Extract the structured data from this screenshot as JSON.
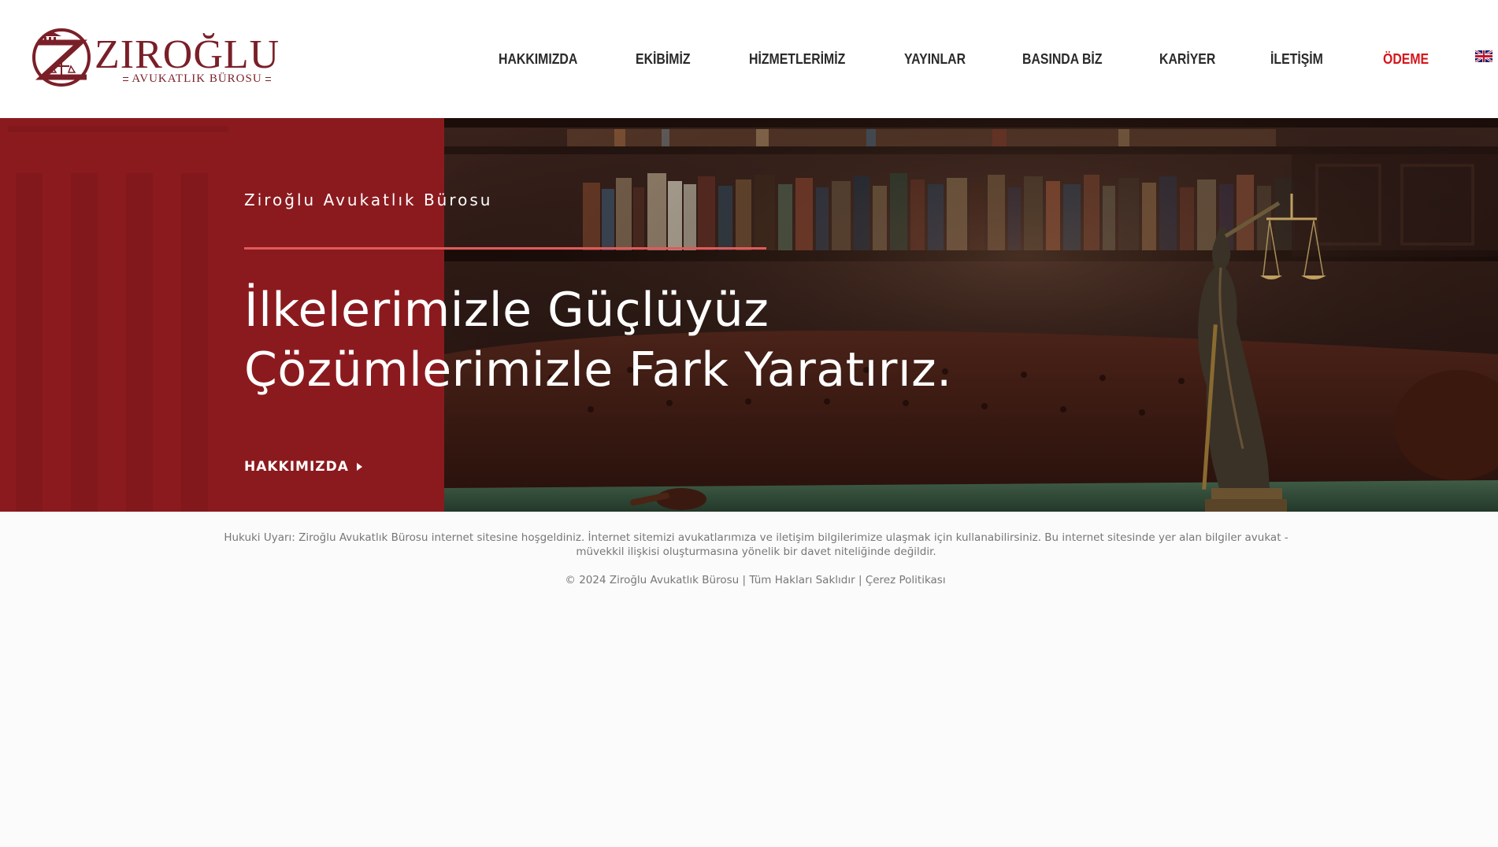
{
  "brand": {
    "name": "ZIROĞLU",
    "subtitle": "AVUKATLIK BÜROSU",
    "colors": {
      "primary": "#7a1f28",
      "accent": "#d4161b",
      "hero_panel": "#8b1a1e"
    }
  },
  "nav": {
    "items": [
      {
        "label": "HAKKIMIZDA"
      },
      {
        "label": "EKİBİMİZ"
      },
      {
        "label": "HİZMETLERİMİZ"
      },
      {
        "label": "YAYINLAR"
      },
      {
        "label": "BASINDA BİZ"
      },
      {
        "label": "KARİYER"
      },
      {
        "label": "İLETİŞİM"
      },
      {
        "label": "ÖDEME",
        "accent": true
      }
    ],
    "language_icon": "uk-flag-icon"
  },
  "hero": {
    "eyebrow": "Ziroğlu Avukatlık Bürosu",
    "headline_line1": "İlkelerimizle Güçlüyüz",
    "headline_line2": "Çözümlerimizle Fark Yaratırız.",
    "cta_label": "HAKKIMIZDA",
    "cta_icon": "play-arrow-icon"
  },
  "footer": {
    "disclaimer": "Hukuki Uyarı: Ziroğlu Avukatlık Bürosu internet sitesine hoşgeldiniz. İnternet sitemizi avukatlarımıza ve iletişim bilgilerimize ulaşmak için kullanabilirsiniz. Bu internet sitesinde yer alan bilgiler avukat - müvekkil ilişkisi oluşturmasına yönelik bir davet niteliğinde değildir.",
    "copyright": "© 2024 Ziroğlu Avukatlık Bürosu",
    "separator": "|",
    "rights": "Tüm Hakları Saklıdır",
    "cookie_policy": "Çerez Politikası"
  }
}
